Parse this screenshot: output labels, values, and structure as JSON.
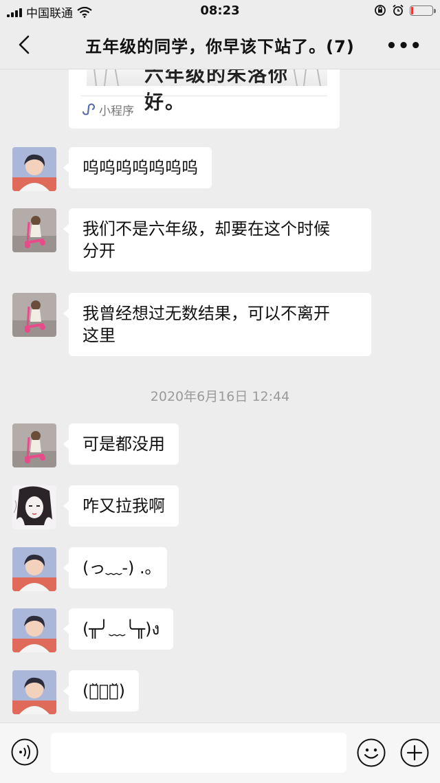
{
  "status_bar": {
    "carrier": "中国联通",
    "time": "08:23"
  },
  "header": {
    "title": "五年级的同学，你早该下站了。(7)",
    "more_icon": "more-dots-icon",
    "back_icon": "chevron-left-icon"
  },
  "card": {
    "image_text": "六年级的朱洛你好。",
    "label": "小程序"
  },
  "messages": [
    {
      "text": "呜呜呜呜呜呜呜"
    },
    {
      "line1": "我们不是六年级，却要在这个时候",
      "line2": "分开"
    },
    {
      "line1": "我曾经想过无数结果，可以不离开",
      "line2": "这里"
    },
    {
      "text": "可是都没用"
    },
    {
      "text": "咋又拉我啊"
    },
    {
      "text": "(っ﹏-) .｡"
    },
    {
      "text": "(╥╯﹏╰╥)ง"
    },
    {
      "text": "(๏̆﹏๏̆)"
    }
  ],
  "timestamp": "2020年6月16日 12:44",
  "input": {
    "value": "",
    "placeholder": ""
  },
  "colors": {
    "background": "#ededed",
    "bubble": "#ffffff",
    "timestamp": "#9a9a9a",
    "battery_low": "#e33333"
  }
}
